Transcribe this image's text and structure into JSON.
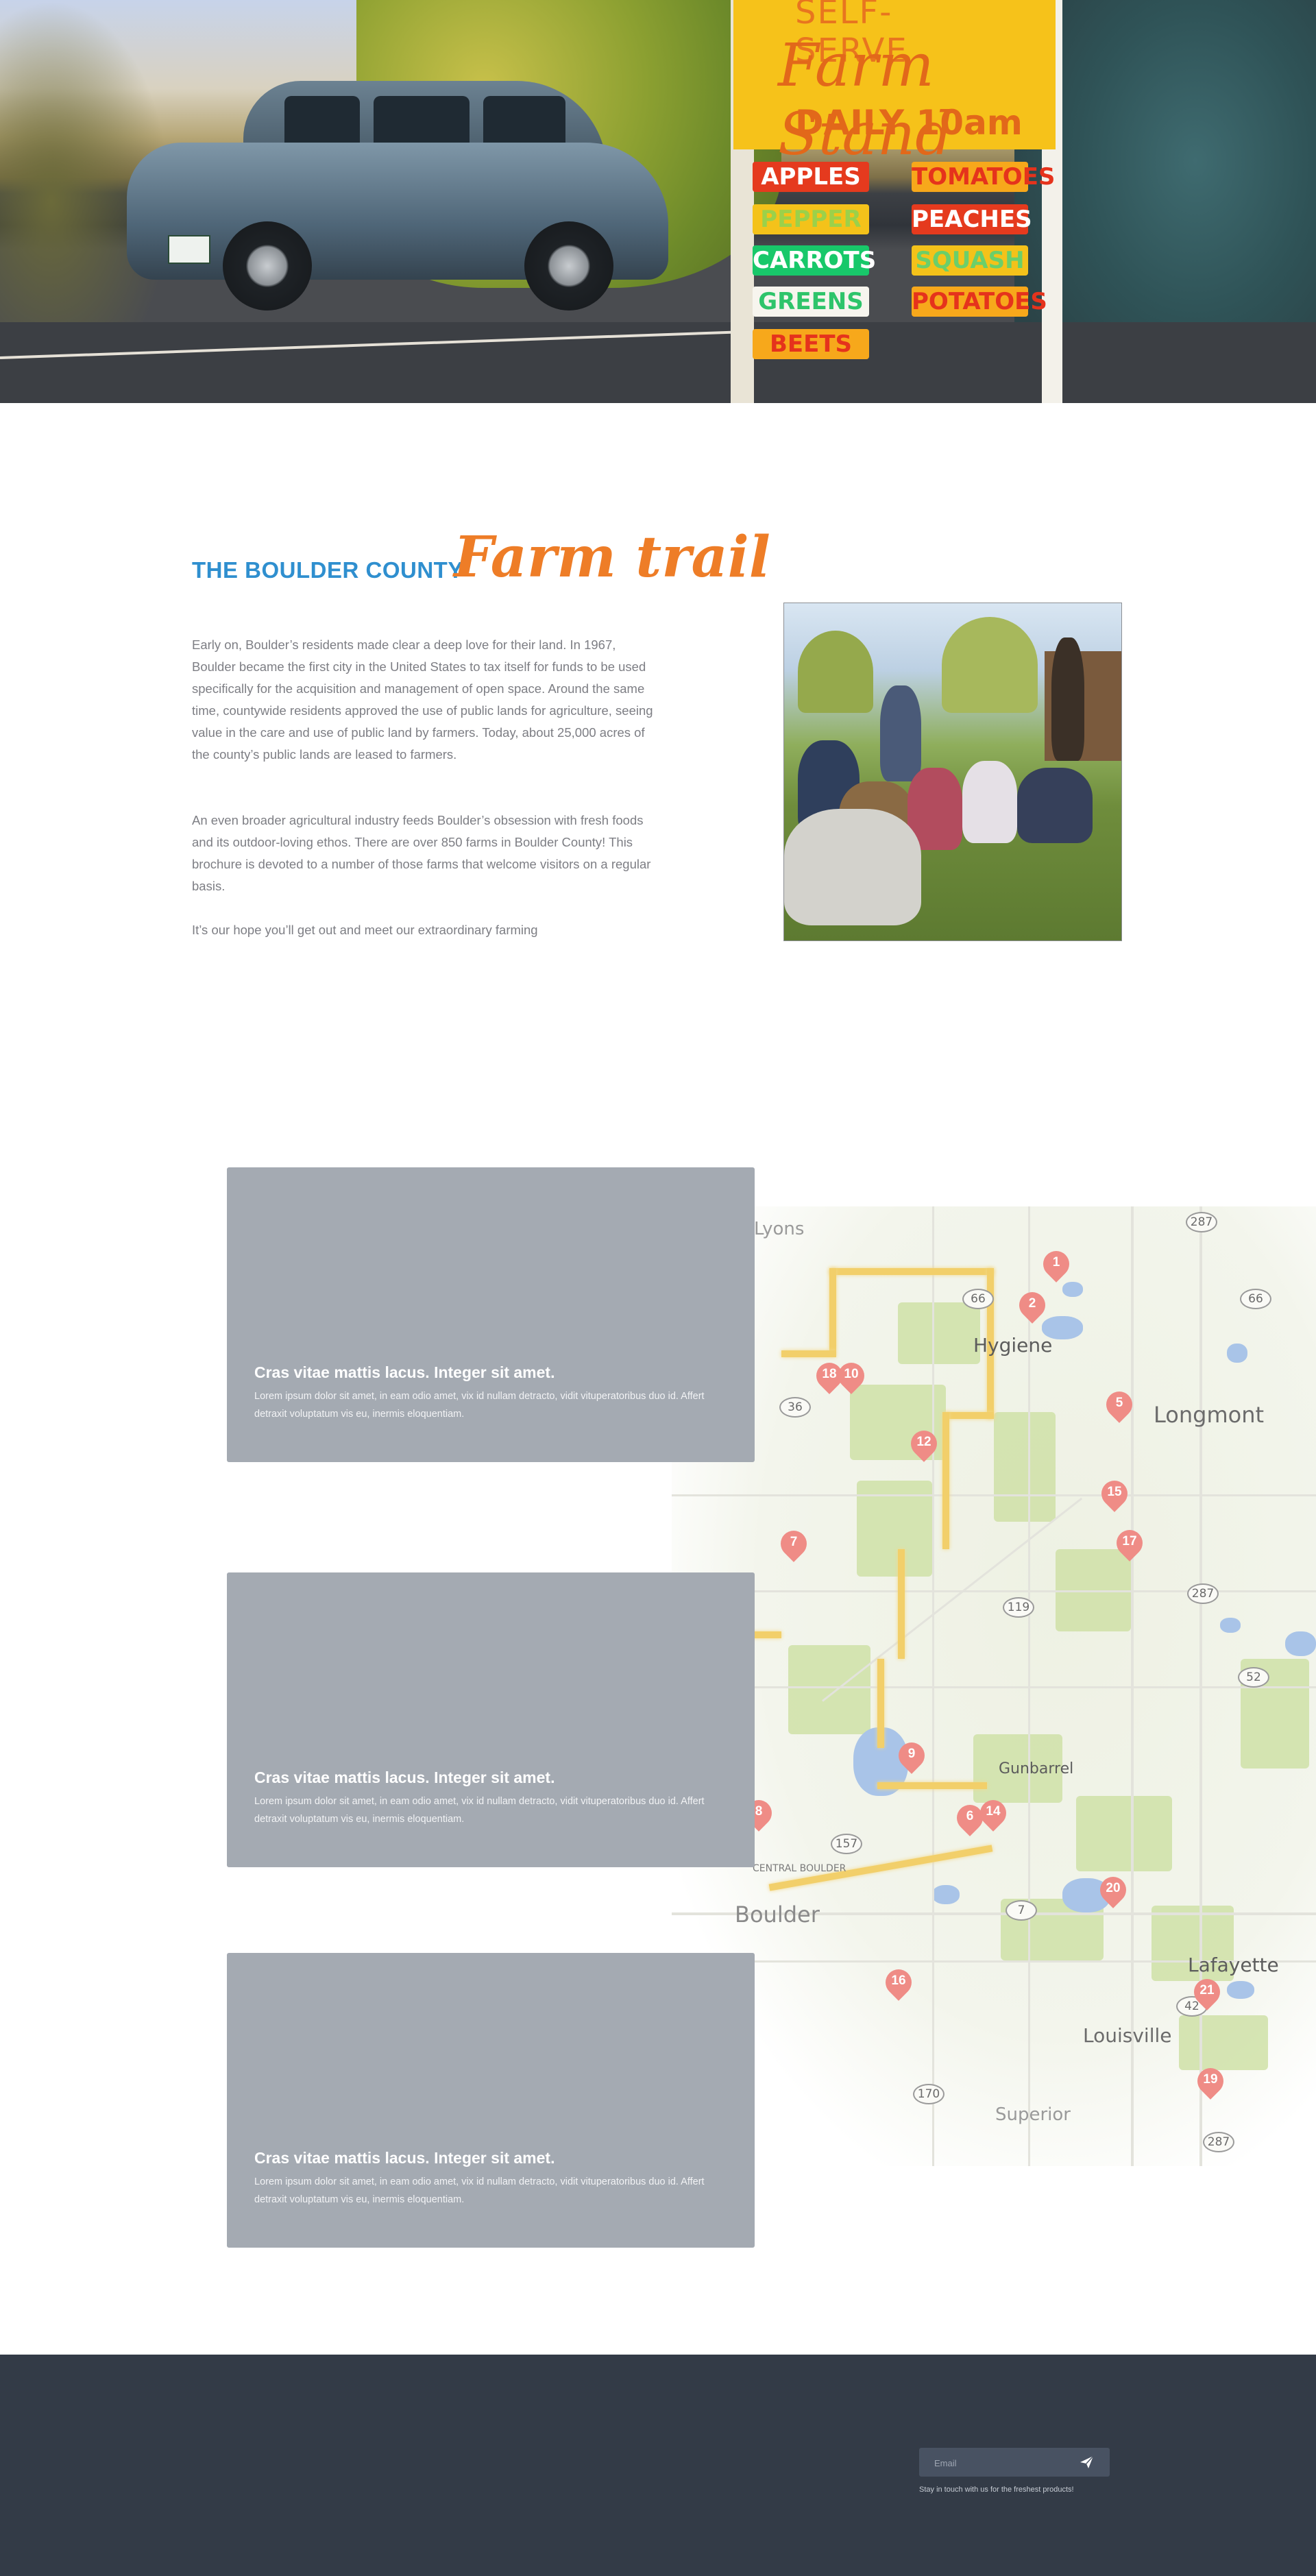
{
  "hero": {
    "sign_top": "SELF-SERVE",
    "sign_title": "Farm Stand",
    "sign_daily": "DAILY 10am",
    "produce_left": [
      "APPLES",
      "PEPPER",
      "CARROTS",
      "GREENS",
      "BEETS"
    ],
    "produce_right": [
      "TOMATOES",
      "PEACHES",
      "SQUASH",
      "POTATOES"
    ]
  },
  "intro": {
    "heading_small": "THE BOULDER COUNTY",
    "heading_script": "Farm trail",
    "paragraphs": [
      "Early on, Boulder’s residents made clear a deep love for their land. In 1967, Boulder became the first city in the United States to tax itself for funds to be used specifically for the acquisition and management of open space. Around the same time,  countywide residents approved the use of public lands for agriculture, seeing value in the care and use of public land by farmers. Today, about 25,000 acres of the county’s public lands are leased to farmers.",
      "An even broader agricultural industry feeds Boulder’s obsession with fresh foods and its outdoor-loving ethos. There are over 850 farms in Boulder County! This brochure is devoted to a number of those farms that welcome visitors on a regular basis.",
      "It’s our hope you’ll get out and meet our extraordinary farming"
    ]
  },
  "map": {
    "places": [
      "Lyons",
      "Hygiene",
      "Longmont",
      "Gunbarrel",
      "Boulder",
      "Lafayette",
      "Louisville",
      "Superior",
      "CENTRAL BOULDER"
    ],
    "shields": [
      "287",
      "66",
      "66",
      "36",
      "119",
      "287",
      "52",
      "157",
      "7",
      "42",
      "170",
      "287"
    ],
    "pins": [
      "1",
      "2",
      "18",
      "10",
      "5",
      "12",
      "15",
      "17",
      "7",
      "9",
      "6",
      "14",
      "8",
      "20",
      "16",
      "21",
      "19"
    ]
  },
  "cards": [
    {
      "title": "Cras vitae mattis lacus. Integer sit amet.",
      "body": "Lorem ipsum dolor sit amet, in eam odio amet, vix id nullam detracto, vidit vituperatoribus duo id. Affert detraxit voluptatum vis eu, inermis eloquentiam."
    },
    {
      "title": "Cras vitae mattis lacus. Integer sit amet.",
      "body": "Lorem ipsum dolor sit amet, in eam odio amet, vix id nullam detracto, vidit vituperatoribus duo id. Affert detraxit voluptatum vis eu, inermis eloquentiam."
    },
    {
      "title": "Cras vitae mattis lacus. Integer sit amet.",
      "body": "Lorem ipsum dolor sit amet, in eam odio amet, vix id nullam detracto, vidit vituperatoribus duo id. Affert detraxit voluptatum vis eu, inermis eloquentiam."
    }
  ],
  "footer": {
    "email_placeholder": "Email",
    "send_icon": "paper-plane-icon",
    "note": "Stay in touch with us for the freshest products!"
  },
  "colors": {
    "accent_blue": "#2f8fcf",
    "accent_orange": "#ee7d27",
    "card_gray": "#a4aab2",
    "footer_bg": "#333b47",
    "pin": "#ef8c86"
  }
}
